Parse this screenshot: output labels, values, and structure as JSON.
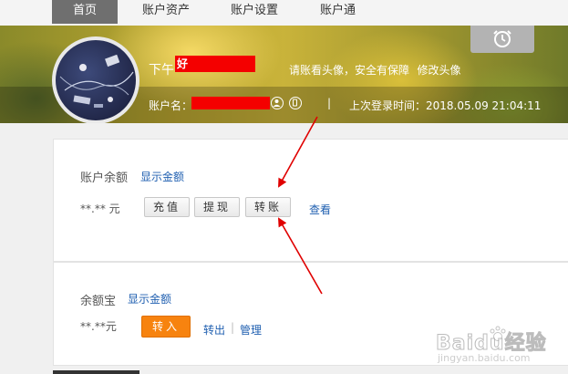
{
  "nav": {
    "items": [
      {
        "label": "首页",
        "active": true
      },
      {
        "label": "账户资产",
        "active": false
      },
      {
        "label": "账户设置",
        "active": false
      },
      {
        "label": "账户通",
        "active": false
      }
    ]
  },
  "header": {
    "greeting_prefix": "下午",
    "greeting_name": "好",
    "avatar_tip": "请账看头像，安全有保障",
    "edit_avatar_link": "修改头像",
    "account_label": "账户名：",
    "separator": "|",
    "last_login_label": "上次登录时间：",
    "last_login_time": "2018.05.09 21:04:11"
  },
  "balance": {
    "title": "账户余额",
    "show_amount_link": "显示金额",
    "amount": "**.** 元",
    "recharge_button": "充值",
    "withdraw_button": "提现",
    "transfer_button": "转账",
    "view_link": "查看"
  },
  "yuebao": {
    "title": "余额宝",
    "show_amount_link": "显示金额",
    "amount": "**.**元",
    "transfer_in_button": "转入",
    "transfer_out_link": "转出",
    "manage_link": "管理",
    "separator": "|"
  },
  "watermark": {
    "brand": "Baidu经验",
    "url": "jingyan.baidu.com"
  },
  "colors": {
    "accent_orange": "#f7830f",
    "link_blue": "#1f5fb0",
    "annotation_red": "#e00000",
    "redaction_red": "#f40000"
  }
}
